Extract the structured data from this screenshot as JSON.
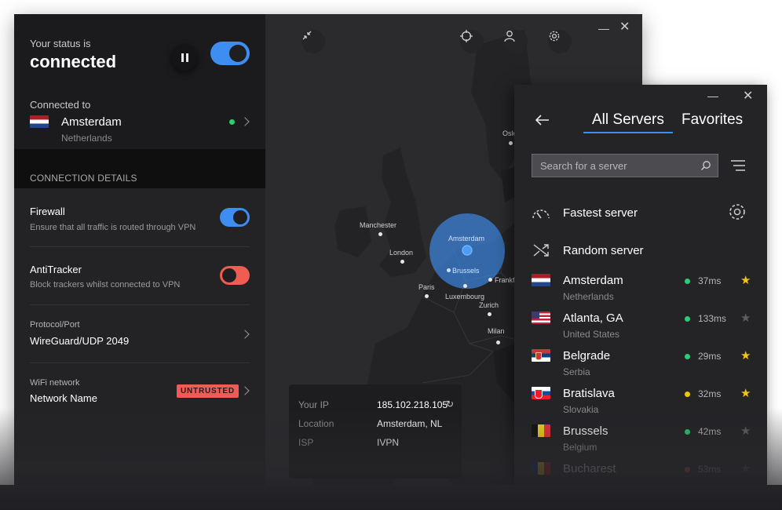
{
  "main": {
    "status": {
      "label": "Your status is",
      "value": "connected"
    },
    "connection": {
      "label": "Connected to",
      "city": "Amsterdam",
      "country": "Netherlands"
    },
    "details_header": "CONNECTION DETAILS",
    "firewall": {
      "title": "Firewall",
      "subtitle": "Ensure that all traffic is routed through VPN",
      "enabled": true
    },
    "antitracker": {
      "title": "AntiTracker",
      "subtitle": "Block trackers whilst connected to VPN",
      "enabled": false
    },
    "protocol": {
      "label": "Protocol/Port",
      "value": "WireGuard/UDP 2049"
    },
    "wifi": {
      "label": "WiFi network",
      "value": "Network Name",
      "badge": "UNTRUSTED"
    }
  },
  "map": {
    "cities": {
      "oslo": "Oslo",
      "manchester": "Manchester",
      "london": "London",
      "amsterdam": "Amsterdam",
      "brussels": "Brussels",
      "paris": "Paris",
      "luxembourg": "Luxembourg",
      "frankfurt": "Frankf",
      "zurich": "Zurich",
      "milan": "Milan"
    },
    "info": {
      "ip_label": "Your IP",
      "ip_value": "185.102.218.105",
      "location_label": "Location",
      "location_value": "Amsterdam, NL",
      "isp_label": "ISP",
      "isp_value": "IVPN"
    }
  },
  "servers": {
    "tabs": [
      "All Servers",
      "Favorites"
    ],
    "search_placeholder": "Search for a server",
    "fastest": "Fastest server",
    "random": "Random server",
    "list": [
      {
        "city": "Amsterdam",
        "country": "Netherlands",
        "ping": "37ms",
        "status": "green",
        "favorite": true,
        "flag": "nl"
      },
      {
        "city": "Atlanta, GA",
        "country": "United States",
        "ping": "133ms",
        "status": "green",
        "favorite": false,
        "flag": "us"
      },
      {
        "city": "Belgrade",
        "country": "Serbia",
        "ping": "29ms",
        "status": "green",
        "favorite": true,
        "flag": "rs"
      },
      {
        "city": "Bratislava",
        "country": "Slovakia",
        "ping": "32ms",
        "status": "yellow",
        "favorite": true,
        "flag": "sk"
      },
      {
        "city": "Brussels",
        "country": "Belgium",
        "ping": "42ms",
        "status": "green",
        "favorite": false,
        "flag": "be"
      },
      {
        "city": "Bucharest",
        "country": "",
        "ping": "53ms",
        "status": "red",
        "favorite": false,
        "flag": "ro"
      }
    ]
  },
  "colors": {
    "accent": "#3d8ef0",
    "danger": "#f05c52",
    "good": "#2ecc71",
    "warn": "#f1c40f"
  }
}
